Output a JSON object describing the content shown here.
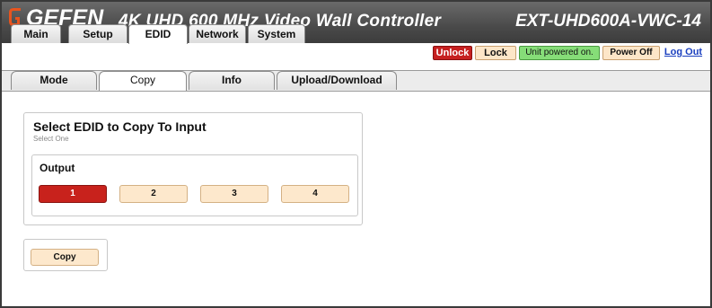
{
  "header": {
    "brand": "GEFEN",
    "title": "4K UHD 600 MHz Video Wall Controller",
    "model": "EXT-UHD600A-VWC-14",
    "logo_icon": "gefen-logo-icon",
    "colors": {
      "header_bg": "#4a4a4a",
      "logo_accent": "#e8541e"
    }
  },
  "main_tabs": [
    {
      "label": "Main",
      "active": false
    },
    {
      "label": "Setup",
      "active": false
    },
    {
      "label": "EDID",
      "active": true
    },
    {
      "label": "Network",
      "active": false
    },
    {
      "label": "System",
      "active": false
    }
  ],
  "controls": {
    "unlock_label": "Unlock",
    "lock_label": "Lock",
    "status_text": "Unit powered on.",
    "power_label": "Power Off",
    "logout_label": "Log Out",
    "colors": {
      "unlock": "#c62020",
      "status": "#86dd78",
      "button": "#fde6c8"
    }
  },
  "sub_tabs": [
    {
      "label": "Mode",
      "active": false
    },
    {
      "label": "Copy",
      "active": true
    },
    {
      "label": "Info",
      "active": false
    },
    {
      "label": "Upload/Download",
      "active": false
    }
  ],
  "edid_copy": {
    "title": "Select EDID to Copy To Input",
    "subtitle": "Select One",
    "output_label": "Output",
    "options": [
      "1",
      "2",
      "3",
      "4"
    ],
    "selected": "1",
    "colors": {
      "selected": "#c8221c",
      "unselected": "#fde8cc"
    }
  },
  "actions": {
    "copy_label": "Copy"
  }
}
